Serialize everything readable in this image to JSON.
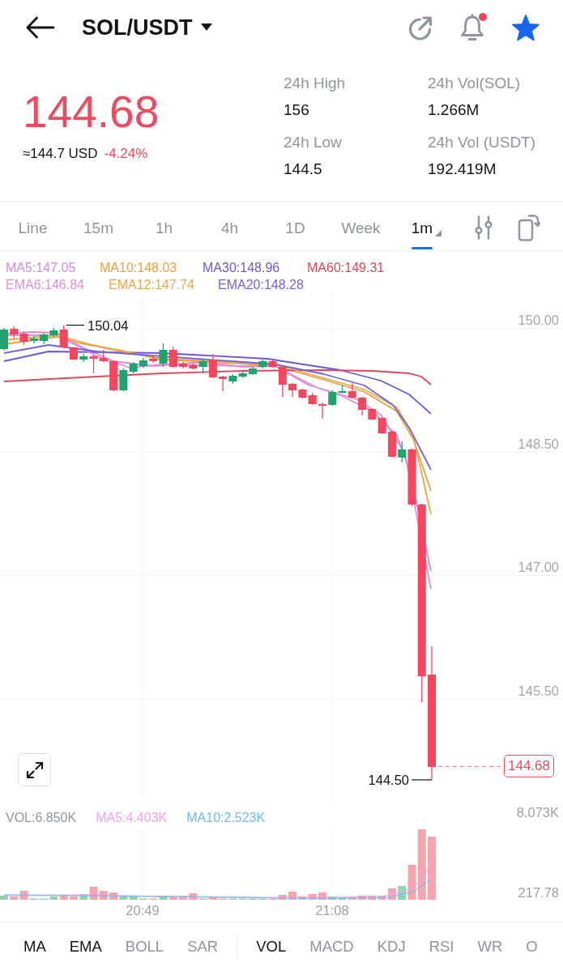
{
  "header": {
    "pair": "SOL/USDT",
    "alert_dot": true,
    "favorite": true
  },
  "ticker": {
    "price": "144.68",
    "approx_usd": "≈144.7 USD",
    "change": "-4.24%",
    "falling": true
  },
  "stats": [
    {
      "label": "24h High",
      "value": "156"
    },
    {
      "label": "24h Vol(SOL)",
      "value": "1.266M"
    },
    {
      "label": "24h Low",
      "value": "144.5"
    },
    {
      "label": "24h Vol (USDT)",
      "value": "192.419M"
    }
  ],
  "intervals": [
    {
      "label": "Line",
      "selected": false,
      "dropdown": false
    },
    {
      "label": "15m",
      "selected": false,
      "dropdown": false
    },
    {
      "label": "1h",
      "selected": false,
      "dropdown": false
    },
    {
      "label": "4h",
      "selected": false,
      "dropdown": false
    },
    {
      "label": "1D",
      "selected": false,
      "dropdown": false
    },
    {
      "label": "Week",
      "selected": false,
      "dropdown": false
    },
    {
      "label": "1m",
      "selected": true,
      "dropdown": true
    }
  ],
  "indicator_rows": [
    {
      "items": [
        {
          "label": "MA5:147.05",
          "color": "#d98ad9"
        },
        {
          "label": "MA10:148.03",
          "color": "#e9a23e"
        },
        {
          "label": "MA30:148.96",
          "color": "#6c56d9"
        },
        {
          "label": "MA60:149.31",
          "color": "#d9495d"
        }
      ]
    },
    {
      "items": [
        {
          "label": "EMA6:146.84",
          "color": "#dd90dd"
        },
        {
          "label": "EMA12:147.74",
          "color": "#eea744"
        },
        {
          "label": "EMA20:148.28",
          "color": "#7564e0"
        }
      ]
    }
  ],
  "chart": {
    "price_ticks": [
      "150.00",
      "148.50",
      "147.00",
      "145.50"
    ],
    "high_label": "150.04",
    "low_label": "144.50",
    "last_price": "144.68"
  },
  "volume": {
    "legend": [
      {
        "label": "VOL:6.850K",
        "color": "#8f95a0"
      },
      {
        "label": "MA5:4.403K",
        "color": "#f0a3ec"
      },
      {
        "label": "MA10:2.523K",
        "color": "#6fbce8"
      }
    ],
    "max_tick": "8.073K",
    "min_tick": "217.78",
    "times": [
      "20:49",
      "21:08"
    ]
  },
  "indicator_tabs": {
    "main": [
      {
        "label": "MA",
        "selected": true
      },
      {
        "label": "EMA",
        "selected": true
      },
      {
        "label": "BOLL",
        "selected": false
      },
      {
        "label": "SAR",
        "selected": false
      }
    ],
    "sub": [
      {
        "label": "VOL",
        "selected": true
      },
      {
        "label": "MACD",
        "selected": false
      },
      {
        "label": "KDJ",
        "selected": false
      },
      {
        "label": "RSI",
        "selected": false
      },
      {
        "label": "WR",
        "selected": false
      },
      {
        "label": "O",
        "selected": false
      }
    ]
  }
}
